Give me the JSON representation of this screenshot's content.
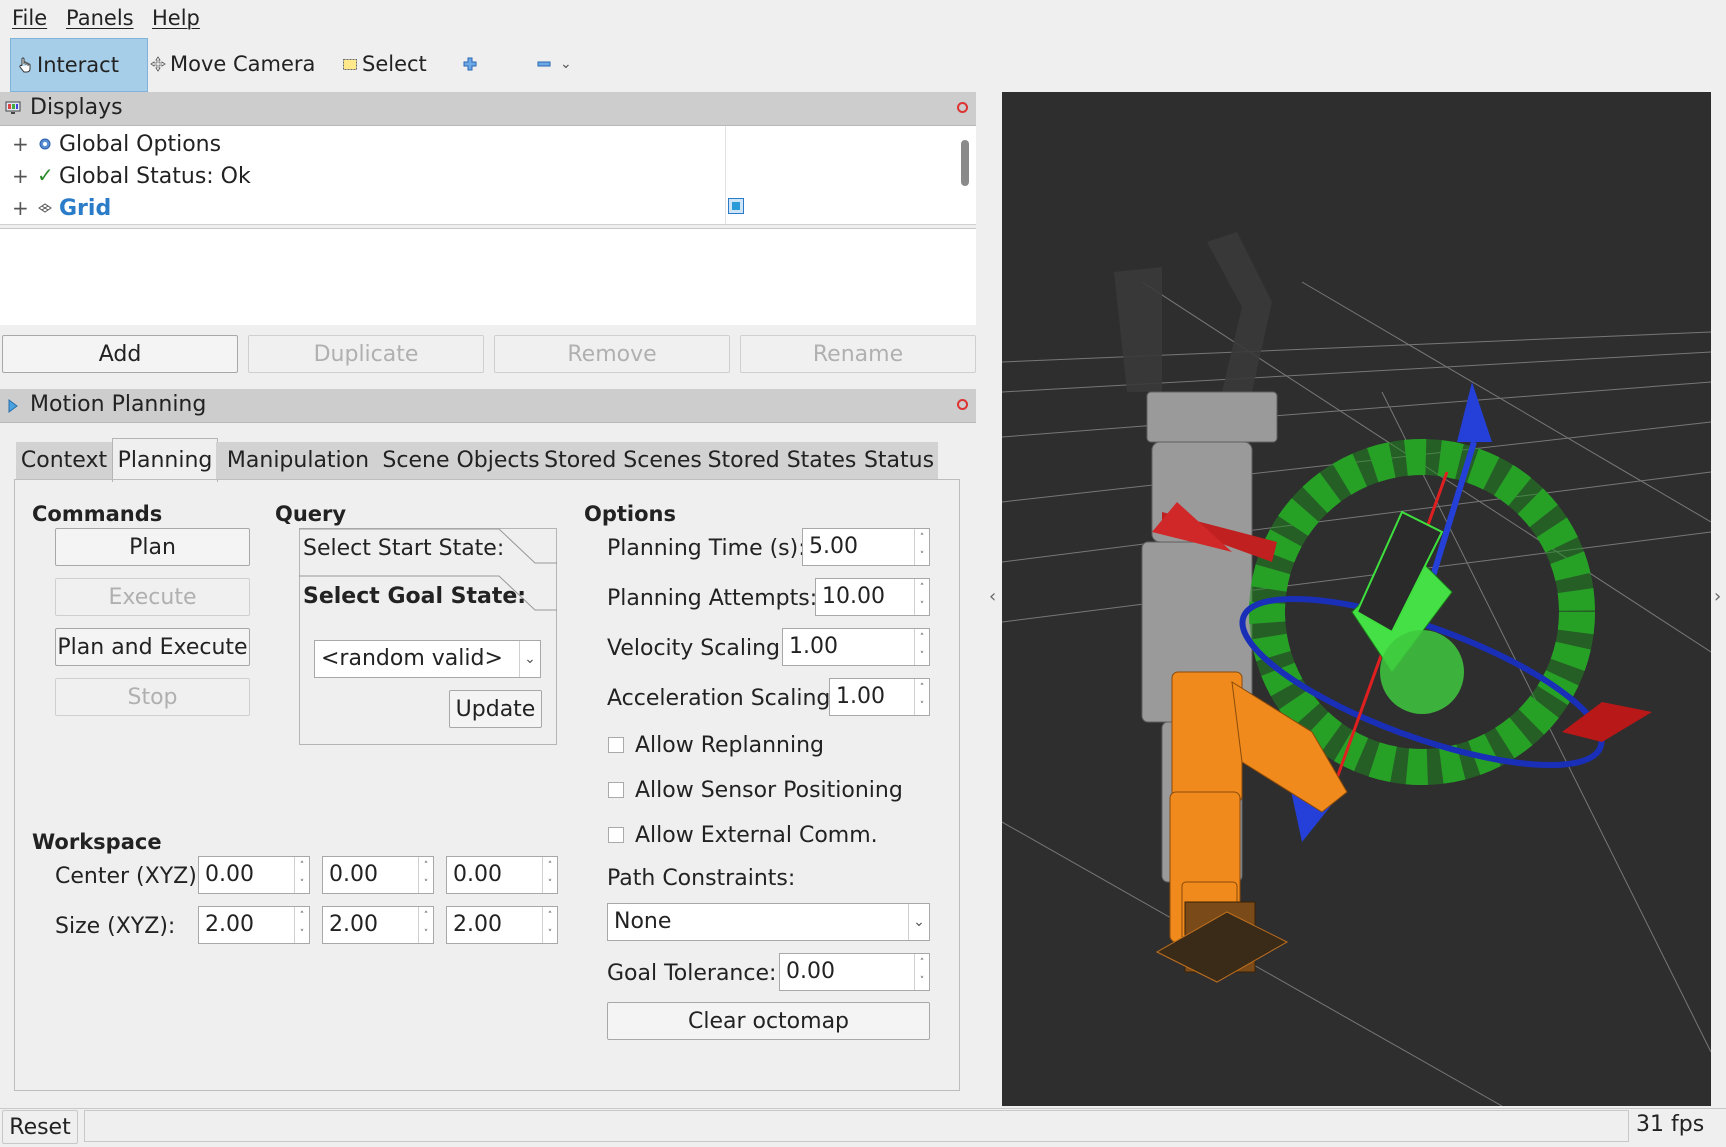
{
  "menu": {
    "file": "File",
    "panels": "Panels",
    "help": "Help"
  },
  "toolbar": {
    "interact": "Interact",
    "move_camera": "Move Camera",
    "select": "Select",
    "plus_icon": "plus-icon",
    "minus_icon": "minus-icon",
    "dropdown_icon": "chevron-down-icon"
  },
  "displays": {
    "title": "Displays",
    "rows": [
      {
        "label": "Global Options",
        "icon": "gear-icon"
      },
      {
        "label": "Global Status: Ok",
        "icon": "check-icon"
      },
      {
        "label": "Grid",
        "icon": "grid-icon",
        "checked": true
      }
    ],
    "buttons": {
      "add": "Add",
      "duplicate": "Duplicate",
      "remove": "Remove",
      "rename": "Rename"
    }
  },
  "motion_planning": {
    "title": "Motion Planning",
    "tabs": [
      "Context",
      "Planning",
      "Manipulation",
      "Scene Objects",
      "Stored Scenes",
      "Stored States",
      "Status"
    ],
    "active_tab": "Planning",
    "commands": {
      "title": "Commands",
      "plan": "Plan",
      "execute": "Execute",
      "plan_and_execute": "Plan and Execute",
      "stop": "Stop"
    },
    "query": {
      "title": "Query",
      "select_start": "Select Start State:",
      "select_goal": "Select Goal State:",
      "goal_value": "<random valid>",
      "update": "Update"
    },
    "options": {
      "title": "Options",
      "planning_time_label": "Planning Time (s):",
      "planning_time": "5.00",
      "planning_attempts_label": "Planning Attempts:",
      "planning_attempts": "10.00",
      "velocity_scaling_label": "Velocity Scaling:",
      "velocity_scaling": "1.00",
      "acceleration_scaling_label": "Acceleration Scaling:",
      "acceleration_scaling": "1.00",
      "allow_replanning": "Allow Replanning",
      "allow_sensor_positioning": "Allow Sensor Positioning",
      "allow_external_comm": "Allow External Comm.",
      "path_constraints_label": "Path Constraints:",
      "path_constraints": "None",
      "goal_tolerance_label": "Goal Tolerance:",
      "goal_tolerance": "0.00",
      "clear_octomap": "Clear octomap"
    },
    "workspace": {
      "title": "Workspace",
      "center_label": "Center (XYZ):",
      "center": [
        "0.00",
        "0.00",
        "0.00"
      ],
      "size_label": "Size (XYZ):",
      "size": [
        "2.00",
        "2.00",
        "2.00"
      ]
    }
  },
  "status_bar": {
    "reset": "Reset",
    "fps": "31 fps"
  },
  "colors": {
    "accent": "#2a7bc8",
    "viewport_bg": "#2e2e2e",
    "robot_orange": "#f08a1c",
    "goal_green": "#3fd43a"
  }
}
